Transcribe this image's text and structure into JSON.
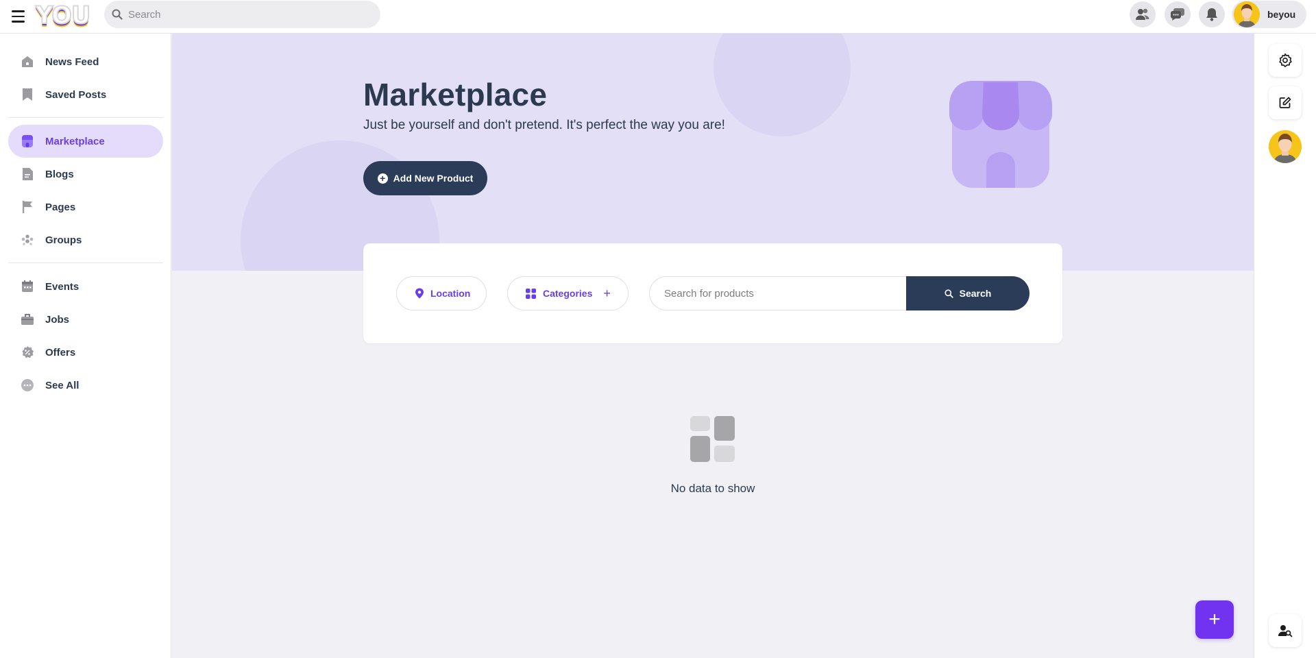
{
  "header": {
    "logo_text": "YOU",
    "search_placeholder": "Search",
    "username": "beyou",
    "icons": [
      "friends-icon",
      "messages-icon",
      "notifications-icon"
    ]
  },
  "sidebar": {
    "items": [
      {
        "label": "News Feed",
        "icon": "house-icon"
      },
      {
        "label": "Saved Posts",
        "icon": "bookmark-icon"
      },
      {
        "label": "Marketplace",
        "icon": "store-icon",
        "active": true
      },
      {
        "label": "Blogs",
        "icon": "document-icon"
      },
      {
        "label": "Pages",
        "icon": "flag-icon"
      },
      {
        "label": "Groups",
        "icon": "group-icon"
      },
      {
        "label": "Events",
        "icon": "calendar-icon"
      },
      {
        "label": "Jobs",
        "icon": "briefcase-icon"
      },
      {
        "label": "Offers",
        "icon": "offer-badge-icon"
      },
      {
        "label": "See All",
        "icon": "more-icon"
      }
    ]
  },
  "hero": {
    "title": "Marketplace",
    "subtitle": "Just be yourself and don't pretend. It's perfect the way you are!",
    "add_button": "Add New Product"
  },
  "filters": {
    "location_label": "Location",
    "categories_label": "Categories",
    "search_placeholder": "Search for products",
    "search_button": "Search"
  },
  "empty_state": {
    "message": "No data to show"
  },
  "colors": {
    "accent": "#6a3ee8",
    "dark": "#2a3c57",
    "hero_bg": "#e3dff7",
    "active_nav_bg": "#e4dcfa",
    "fab": "#7133f0"
  }
}
